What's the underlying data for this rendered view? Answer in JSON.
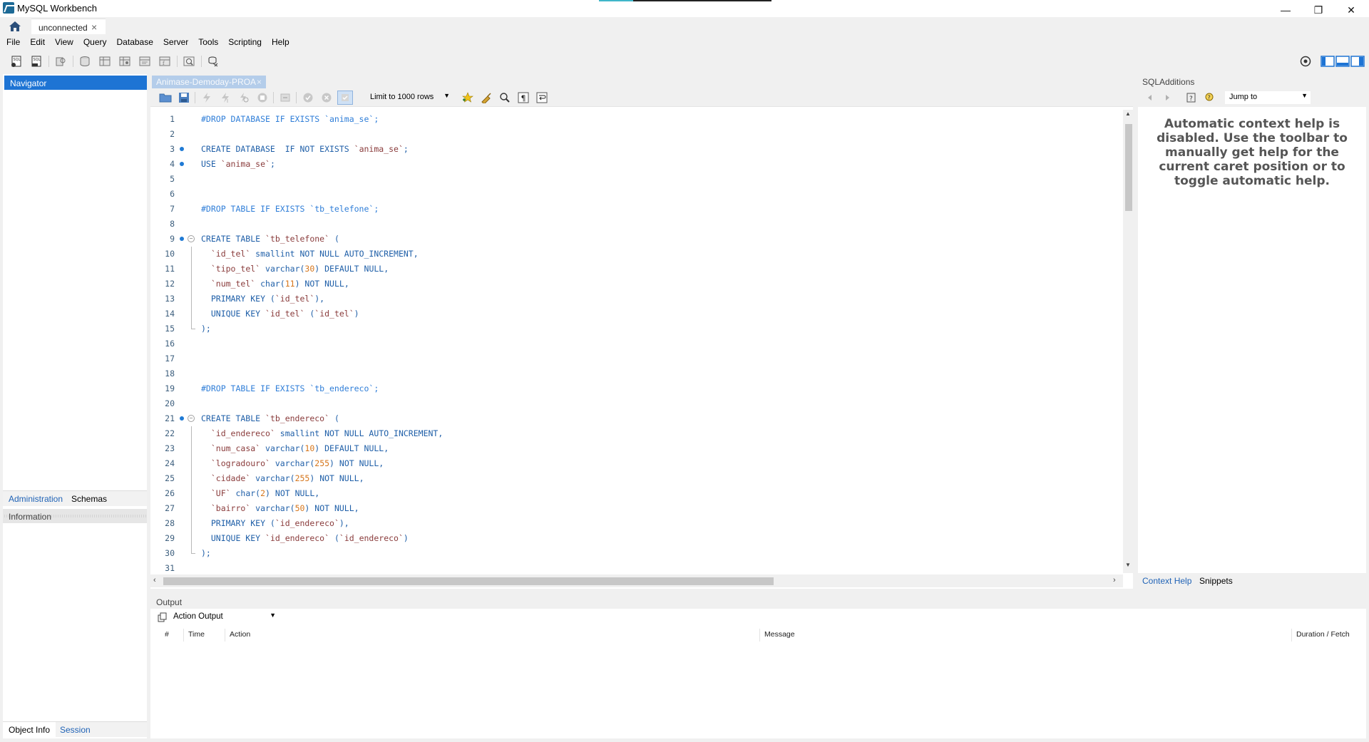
{
  "window": {
    "title": "MySQL Workbench",
    "minimize": "—",
    "restore": "❐",
    "close": "✕"
  },
  "connection_tab": {
    "label": "unconnected",
    "close": "×"
  },
  "menu": [
    "File",
    "Edit",
    "View",
    "Query",
    "Database",
    "Server",
    "Tools",
    "Scripting",
    "Help"
  ],
  "left_panel": {
    "navigator": "Navigator",
    "tabs": [
      "Administration",
      "Schemas"
    ],
    "information": "Information",
    "bottom_tabs": [
      "Object Info",
      "Session"
    ]
  },
  "editor": {
    "tab_label": "Animase-Demoday-PROA",
    "tab_close": "×",
    "limit_select": "Limit to 1000 rows",
    "code_lines": [
      {
        "n": "1",
        "text": "#DROP DATABASE IF EXISTS `anima_se`;"
      },
      {
        "n": "2",
        "text": ""
      },
      {
        "n": "3",
        "text": "CREATE DATABASE  IF NOT EXISTS `anima_se`;"
      },
      {
        "n": "4",
        "text": "USE `anima_se`;"
      },
      {
        "n": "5",
        "text": ""
      },
      {
        "n": "6",
        "text": ""
      },
      {
        "n": "7",
        "text": "#DROP TABLE IF EXISTS `tb_telefone`;"
      },
      {
        "n": "8",
        "text": ""
      },
      {
        "n": "9",
        "text": "CREATE TABLE `tb_telefone` ("
      },
      {
        "n": "10",
        "text": "  `id_tel` smallint NOT NULL AUTO_INCREMENT,"
      },
      {
        "n": "11",
        "text": "  `tipo_tel` varchar(30) DEFAULT NULL,"
      },
      {
        "n": "12",
        "text": "  `num_tel` char(11) NOT NULL,"
      },
      {
        "n": "13",
        "text": "  PRIMARY KEY (`id_tel`),"
      },
      {
        "n": "14",
        "text": "  UNIQUE KEY `id_tel` (`id_tel`)"
      },
      {
        "n": "15",
        "text": ");"
      },
      {
        "n": "16",
        "text": ""
      },
      {
        "n": "17",
        "text": ""
      },
      {
        "n": "18",
        "text": ""
      },
      {
        "n": "19",
        "text": "#DROP TABLE IF EXISTS `tb_endereco`;"
      },
      {
        "n": "20",
        "text": ""
      },
      {
        "n": "21",
        "text": "CREATE TABLE `tb_endereco` ("
      },
      {
        "n": "22",
        "text": "  `id_endereco` smallint NOT NULL AUTO_INCREMENT,"
      },
      {
        "n": "23",
        "text": "  `num_casa` varchar(10) DEFAULT NULL,"
      },
      {
        "n": "24",
        "text": "  `logradouro` varchar(255) NOT NULL,"
      },
      {
        "n": "25",
        "text": "  `cidade` varchar(255) NOT NULL,"
      },
      {
        "n": "26",
        "text": "  `UF` char(2) NOT NULL,"
      },
      {
        "n": "27",
        "text": "  `bairro` varchar(50) NOT NULL,"
      },
      {
        "n": "28",
        "text": "  PRIMARY KEY (`id_endereco`),"
      },
      {
        "n": "29",
        "text": "  UNIQUE KEY `id_endereco` (`id_endereco`)"
      },
      {
        "n": "30",
        "text": ");"
      },
      {
        "n": "31",
        "text": ""
      }
    ]
  },
  "right_panel": {
    "header": "SQLAdditions",
    "jump_to": "Jump to",
    "help_text": "Automatic context help is disabled. Use the toolbar to manually get help for the current caret position or to toggle automatic help.",
    "tabs": [
      "Context Help",
      "Snippets"
    ]
  },
  "output": {
    "header": "Output",
    "select": "Action Output",
    "columns": [
      "#",
      "Time",
      "Action",
      "Message",
      "Duration / Fetch"
    ]
  },
  "colors": {
    "accent": "#1e74d4",
    "keyword": "#1f5fa8",
    "string": "#8a3c3c",
    "number": "#d6761c",
    "comment": "#2f7ed8"
  }
}
